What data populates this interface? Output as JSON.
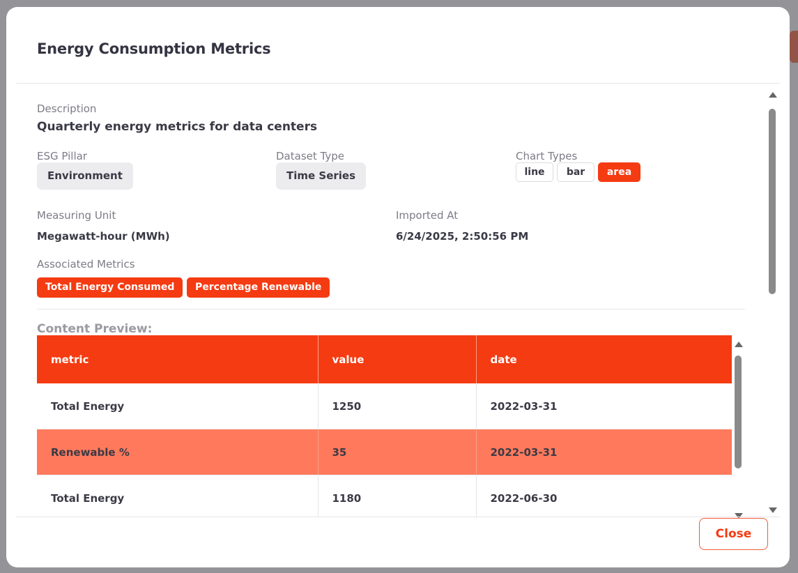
{
  "modal": {
    "title": "Energy Consumption Metrics",
    "description_label": "Description",
    "description": "Quarterly energy metrics for data centers",
    "esg_pillar_label": "ESG Pillar",
    "esg_pillar": "Environment",
    "dataset_type_label": "Dataset Type",
    "dataset_type": "Time Series",
    "chart_types_label": "Chart Types",
    "chart_types": [
      {
        "label": "line",
        "active": false
      },
      {
        "label": "bar",
        "active": false
      },
      {
        "label": "area",
        "active": true
      }
    ],
    "measuring_unit_label": "Measuring Unit",
    "measuring_unit": "Megawatt-hour (MWh)",
    "imported_at_label": "Imported At",
    "imported_at": "6/24/2025, 2:50:56 PM",
    "associated_metrics_label": "Associated Metrics",
    "associated_metrics": [
      "Total Energy Consumed",
      "Percentage Renewable"
    ],
    "content_preview_label": "Content Preview:",
    "table": {
      "columns": [
        "metric",
        "value",
        "date"
      ],
      "rows": [
        {
          "metric": "Total Energy",
          "value": "1250",
          "date": "2022-03-31",
          "highlighted": false
        },
        {
          "metric": "Renewable %",
          "value": "35",
          "date": "2022-03-31",
          "highlighted": true
        },
        {
          "metric": "Total Energy",
          "value": "1180",
          "date": "2022-06-30",
          "highlighted": false
        }
      ]
    },
    "close_label": "Close"
  },
  "colors": {
    "accent": "#f53b12",
    "row_highlight": "#ff7a5c",
    "chip_gray": "#ececef"
  }
}
